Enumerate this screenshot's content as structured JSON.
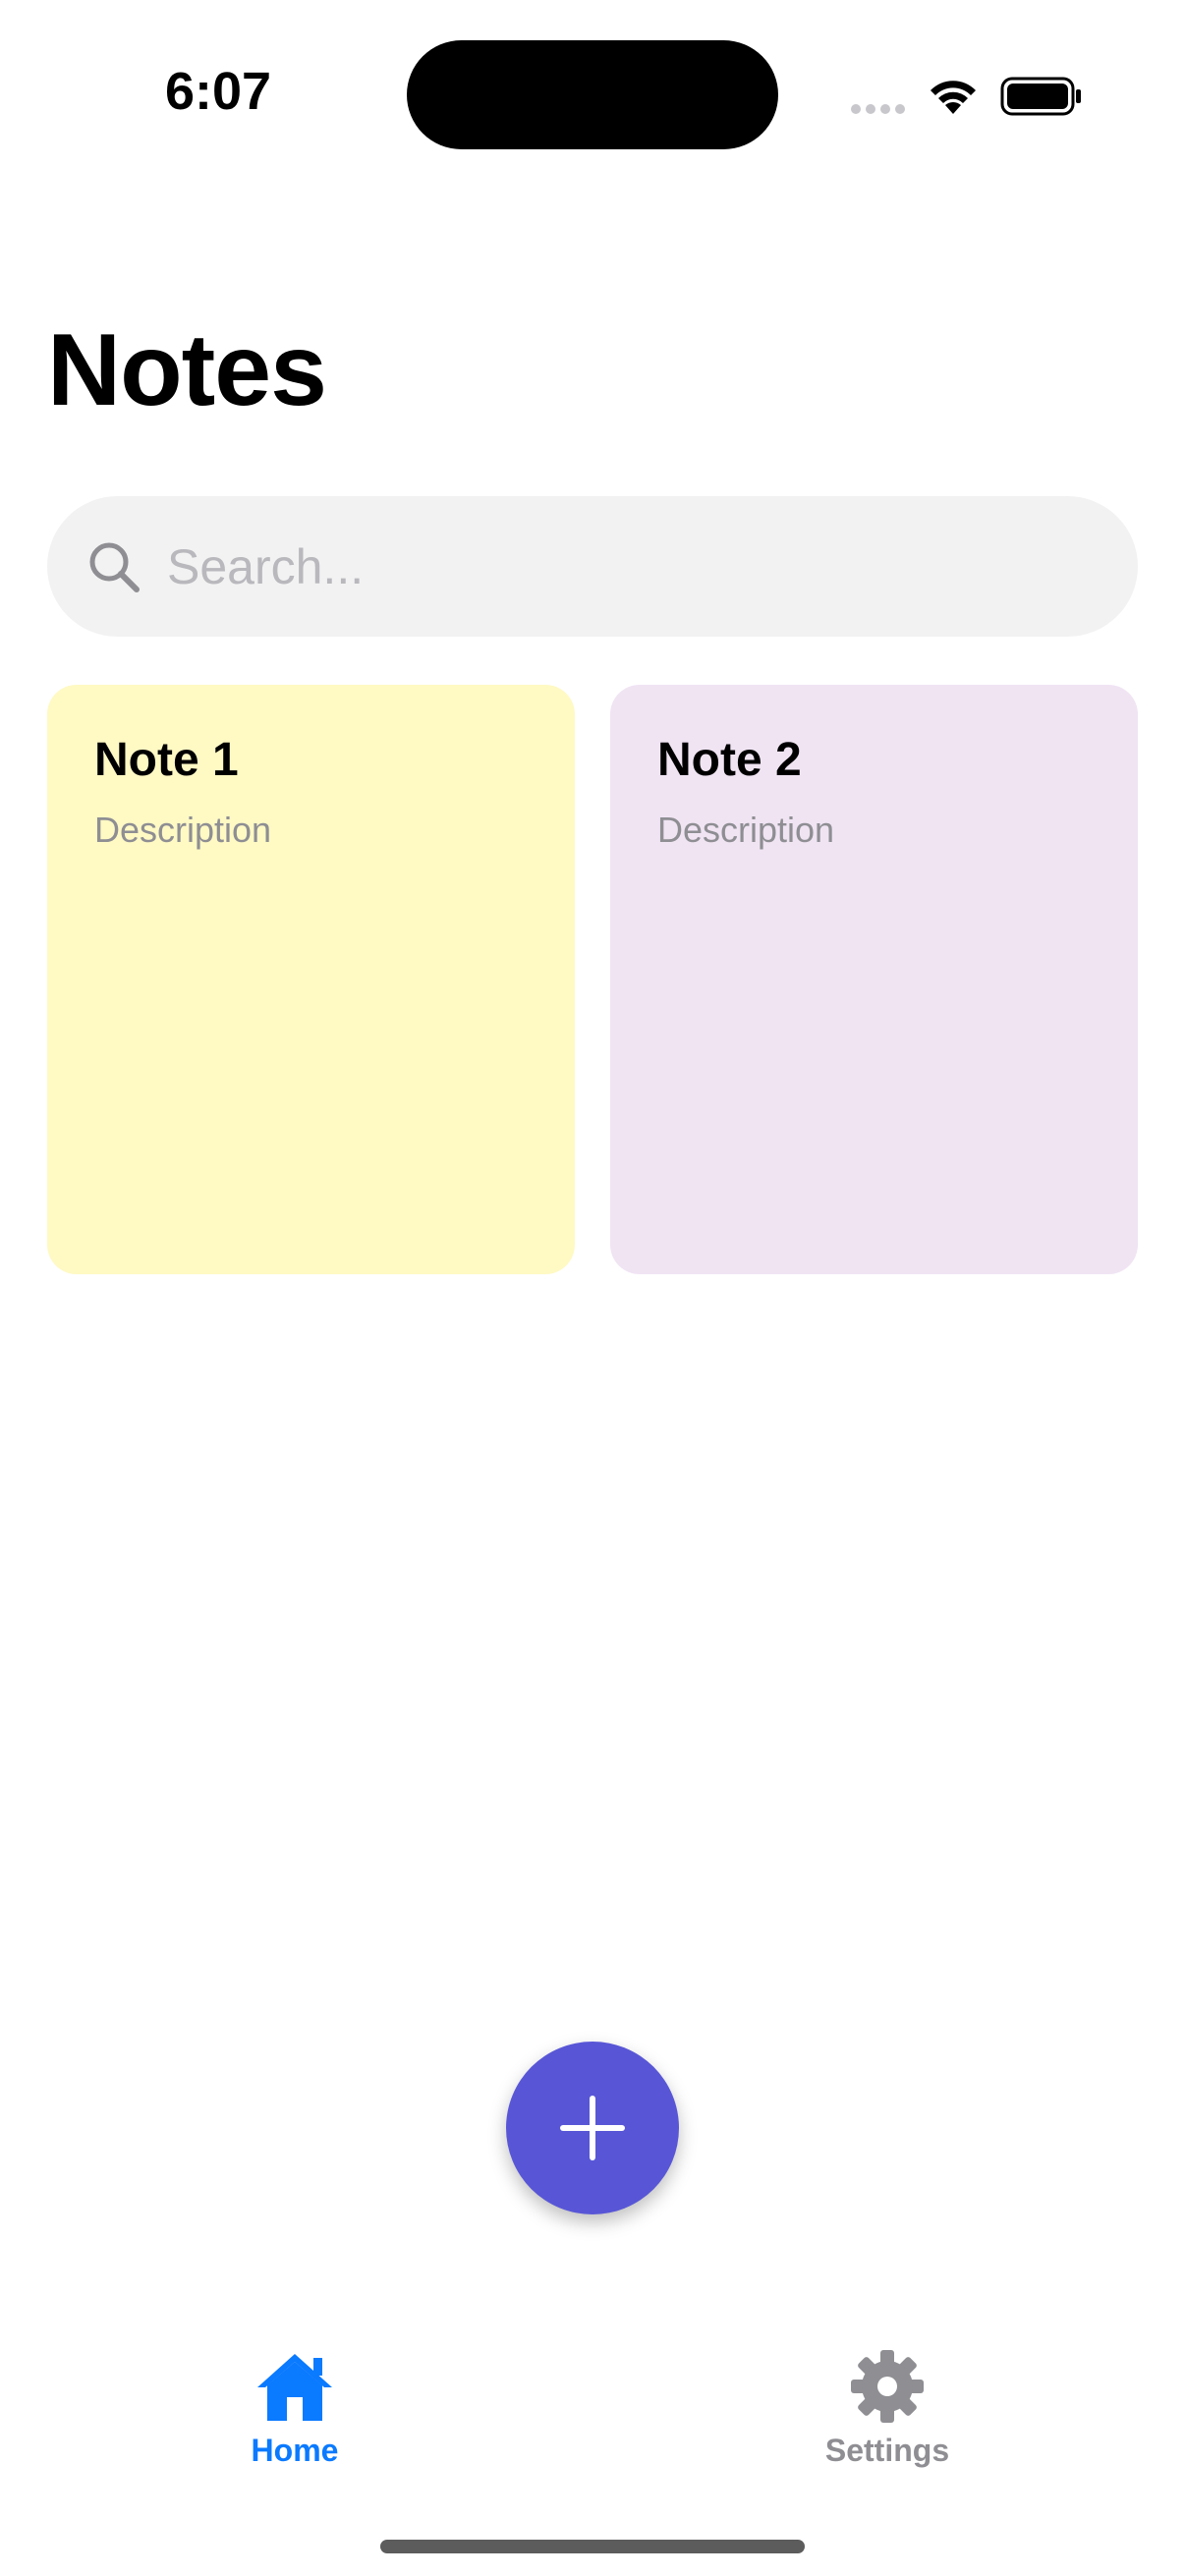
{
  "status_bar": {
    "time": "6:07"
  },
  "header": {
    "title": "Notes"
  },
  "search": {
    "placeholder": "Search...",
    "value": "",
    "icon": "search-icon"
  },
  "notes": [
    {
      "title": "Note 1",
      "description": "Description",
      "color": "#fff9c4"
    },
    {
      "title": "Note 2",
      "description": "Description",
      "color": "#f0e4f3"
    }
  ],
  "fab": {
    "icon": "plus-icon",
    "color": "#5856d6"
  },
  "tabs": [
    {
      "label": "Home",
      "icon": "house-icon",
      "active": true,
      "color": "#0a7aff"
    },
    {
      "label": "Settings",
      "icon": "gear-icon",
      "active": false,
      "color": "#8e8e93"
    }
  ]
}
